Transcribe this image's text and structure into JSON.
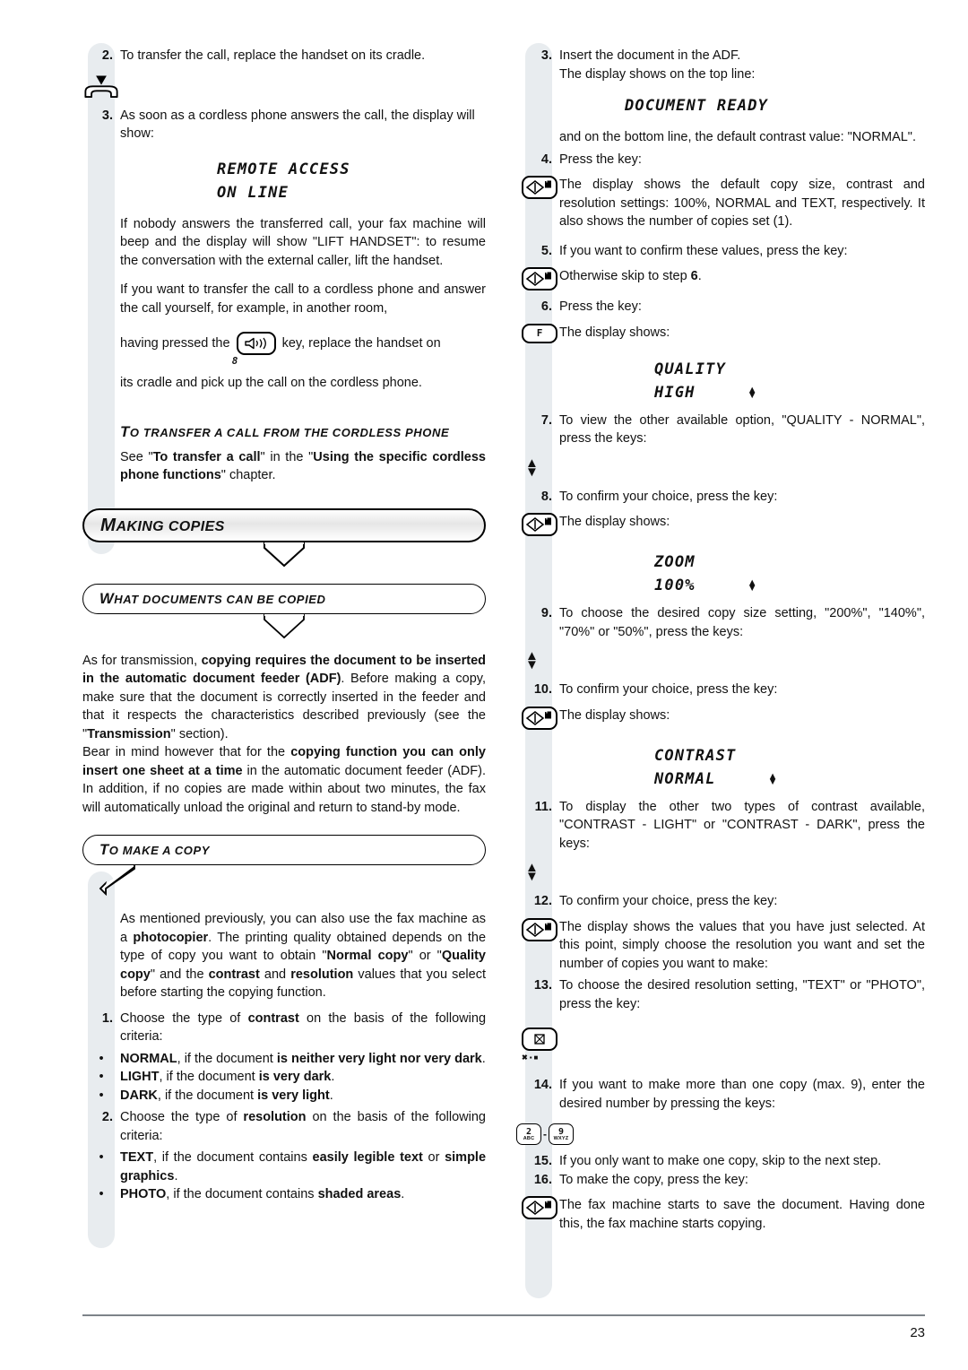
{
  "page_number": "23",
  "left_column": {
    "step2": {
      "num": "2.",
      "text": "To transfer the call, replace the handset on its cradle."
    },
    "handset_icon": "handset-cradle-icon",
    "step3": {
      "num": "3.",
      "text": "As soon as a cordless phone answers the call, the display will show:"
    },
    "display1": {
      "line1": "REMOTE ACCESS",
      "line2": "ON LINE"
    },
    "para1": "If nobody answers the transferred call, your fax machine will beep and the display will show \"LIFT HANDSET\": to resume the conversation with the external caller, lift the handset.",
    "para2_a": "If you want to transfer the call to a cordless phone and answer the call yourself, for example, in another room,",
    "para2_b": "having pressed the",
    "para2_c": "key, replace the handset on",
    "para2_d": "its cradle and pick up the call on the cordless phone.",
    "speaker_key": {
      "icon": "speaker-key-icon",
      "sub_label": "8"
    },
    "subhead_transfer": {
      "cap": "T",
      "rest": "O TRANSFER A CALL FROM THE CORDLESS PHONE"
    },
    "see_text_1": "See \"",
    "see_text_2": "To transfer a call",
    "see_text_3": "\" in the \"",
    "see_text_4": "Using the specific cordless phone functions",
    "see_text_5": "\" chapter.",
    "heading_making_copies": {
      "cap": "M",
      "rest": "AKING COPIES"
    },
    "heading_what_docs": {
      "cap": "W",
      "rest": "HAT DOCUMENTS CAN BE COPIED"
    },
    "copy_para_1a": "As for transmission, ",
    "copy_para_1b": "copying requires the document to be inserted in the automatic document feeder (ADF)",
    "copy_para_1c": ". Before making a copy, make sure that the document is correctly inserted in the feeder and that it respects the characteristics described previously (see the \"",
    "copy_para_1d": "Transmission",
    "copy_para_1e": "\" section).",
    "copy_para_2a": "Bear in mind however that for the ",
    "copy_para_2b": "copying function you can only insert one sheet at a time",
    "copy_para_2c": " in the automatic document feeder (ADF). In addition, if no copies are made within about two minutes, the fax will automatically unload the original and return to stand-by mode.",
    "heading_to_make_copy": {
      "cap": "T",
      "rest": "O MAKE A COPY"
    },
    "make_copy_a": "As mentioned previously, you can also use the fax machine as a ",
    "make_copy_b": "photocopier",
    "make_copy_c": ". The printing quality obtained depends on the type of copy you want to obtain \"",
    "make_copy_d": "Normal copy",
    "make_copy_e": "\" or \"",
    "make_copy_f": "Quality copy",
    "make_copy_g": "\" and the ",
    "make_copy_h": "contrast",
    "make_copy_i": " and ",
    "make_copy_j": "resolution",
    "make_copy_k": " values that you select before starting the copying function.",
    "step1": {
      "num": "1.",
      "a": "Choose the type of ",
      "b": "contrast",
      "c": " on the basis of the following criteria:"
    },
    "bullet_normal": {
      "b1": "NORMAL",
      "t1": ", if the document ",
      "b2": "is neither very light nor very dark",
      "t2": "."
    },
    "bullet_light": {
      "b1": "LIGHT",
      "t1": ", if the document ",
      "b2": "is very dark",
      "t2": "."
    },
    "bullet_dark": {
      "b1": "DARK",
      "t1": ", if the document ",
      "b2": "is very light",
      "t2": "."
    },
    "step2b": {
      "num": "2.",
      "a": "Choose the type of ",
      "b": "resolution",
      "c": " on the basis of the following criteria:"
    },
    "bullet_text": {
      "b1": "TEXT",
      "t1": ", if the document contains ",
      "b2": "easily legible text",
      "t2": " or ",
      "b3": "simple graphics",
      "t3": "."
    },
    "bullet_photo": {
      "b1": "PHOTO",
      "t1": ", if the document contains ",
      "b2": "shaded areas",
      "t2": "."
    }
  },
  "right_column": {
    "step3": {
      "num": "3.",
      "line1": "Insert the document in the ADF.",
      "line2": "The display shows on the top line:"
    },
    "display_document_ready": "DOCUMENT READY",
    "para_bottom_line": "and on the bottom line, the default contrast value: \"NORMAL\".",
    "step4": {
      "num": "4.",
      "text": "Press the key:"
    },
    "key_copy_1": "copy-start-key-icon",
    "step4_result": "The display shows the default copy size, contrast and resolution settings: 100%, NORMAL and TEXT, respectively. It also shows the number of copies set (1).",
    "step5": {
      "num": "5.",
      "text": "If you want to confirm these values, press the key:"
    },
    "step5_result_a": "Otherwise skip to step ",
    "step5_result_b": "6",
    "step5_result_c": ".",
    "step6": {
      "num": "6.",
      "text": "Press the key:"
    },
    "key_f_label": "F",
    "step6_result": "The display shows:",
    "display_quality": {
      "line1": "QUALITY",
      "line2": "HIGH"
    },
    "step7": {
      "num": "7.",
      "text": "To view the other available option, \"QUALITY - NORMAL\", press the keys:"
    },
    "step8": {
      "num": "8.",
      "text": "To confirm your choice, press the key:"
    },
    "step8_result": "The display shows:",
    "display_zoom": {
      "line1": "ZOOM",
      "line2": "100%"
    },
    "step9": {
      "num": "9.",
      "text": "To choose the desired copy size setting, \"200%\", \"140%\", \"70%\" or \"50%\", press the keys:"
    },
    "step10": {
      "num": "10.",
      "text": "To confirm your choice, press the key:"
    },
    "step10_result": "The display shows:",
    "display_contrast": {
      "line1": "CONTRAST",
      "line2": "NORMAL"
    },
    "step11": {
      "num": "11.",
      "text": "To display the other two types of contrast available, \"CONTRAST - LIGHT\" or \"CONTRAST - DARK\", press the keys:"
    },
    "step12": {
      "num": "12.",
      "text": "To confirm your choice, press the key:"
    },
    "step12_result": "The display shows the values that you have just selected. At this point, simply choose the resolution you want and set the number of copies you want to make:",
    "step13": {
      "num": "13.",
      "text": "To choose the desired resolution setting, \"TEXT\" or \"PHOTO\", press the key:"
    },
    "key_resolution": "resolution-key-icon",
    "resolution_marks": "resolution-indicator-marks",
    "step14": {
      "num": "14.",
      "text": "If you want to make more than one copy (max. 9), enter the desired number by pressing the keys:"
    },
    "num_key_2": {
      "digit": "2",
      "letters": "ABC"
    },
    "num_key_9": {
      "digit": "9",
      "letters": "WXYZ"
    },
    "num_key_sep": "-",
    "step15": {
      "num": "15.",
      "text": "If you only want to make one copy, skip to the next step."
    },
    "step16": {
      "num": "16.",
      "text": "To make the copy, press the key:"
    },
    "step16_result": "The fax machine starts to save the document. Having done this, the fax machine starts copying."
  }
}
